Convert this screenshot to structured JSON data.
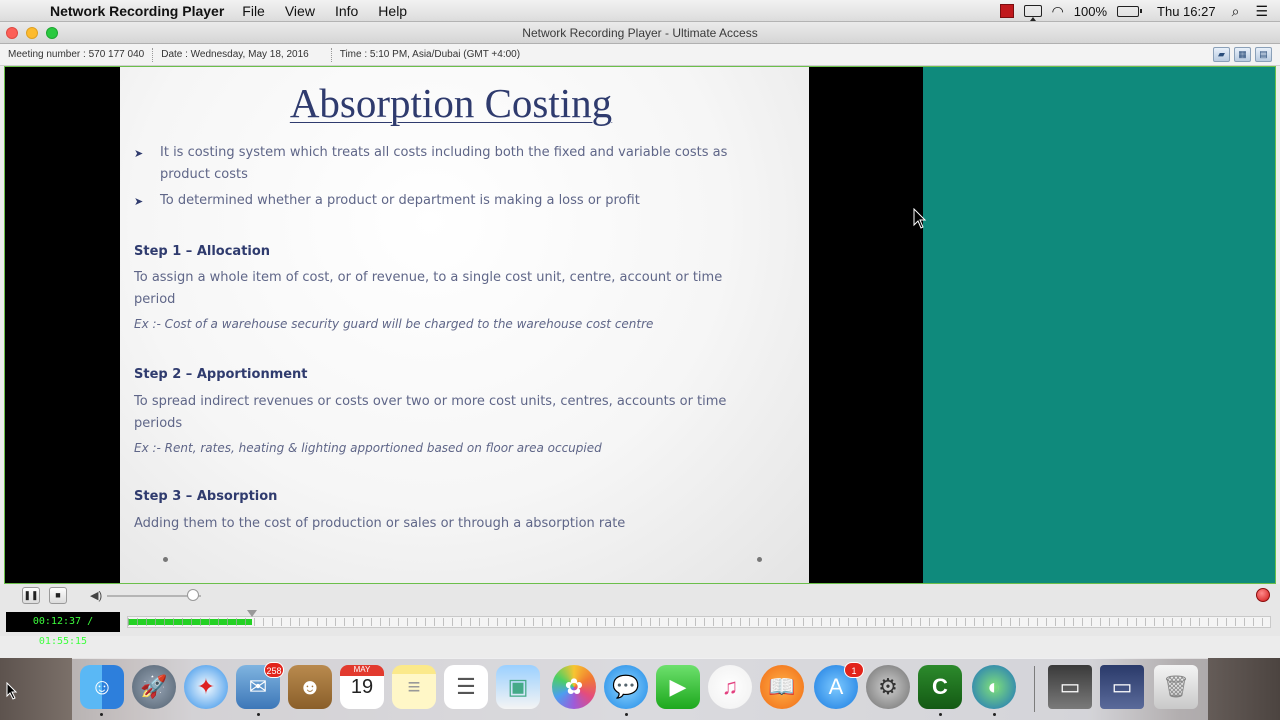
{
  "menubar": {
    "app_name": "Network Recording Player",
    "menus": [
      "File",
      "View",
      "Info",
      "Help"
    ],
    "battery": "100%",
    "clock": "Thu 16:27"
  },
  "window": {
    "title": "Network Recording Player - Ultimate Access",
    "meeting": "Meeting number : 570 177 040",
    "date": "Date : Wednesday, May 18, 2016",
    "time": "Time : 5:10 PM, Asia/Dubai (GMT +4:00)"
  },
  "slide": {
    "title": "Absorption Costing",
    "bullets": [
      "It is costing system which treats all costs including both the fixed and variable costs as",
      "product costs",
      "To determined whether a product or department is making a loss or profit"
    ],
    "steps": [
      {
        "heading": "Step 1 – Allocation",
        "lines": [
          "To assign a whole item of cost, or of revenue, to a single cost unit, centre, account or time",
          "period"
        ],
        "example": "Ex :- Cost of a warehouse security guard will be charged to the warehouse cost centre"
      },
      {
        "heading": "Step 2 – Apportionment",
        "lines": [
          "To spread indirect revenues or costs over two or more cost units, centres, accounts or time",
          "periods"
        ],
        "example": "Ex :- Rent, rates, heating & lighting  apportioned based on floor area occupied"
      },
      {
        "heading": "Step 3 – Absorption",
        "lines": [
          "Adding them to the cost of production or sales or through a absorption rate"
        ]
      }
    ]
  },
  "player": {
    "time_display": "00:12:37 / 01:55:15",
    "progress_fraction": 0.109,
    "volume_fraction": 0.92
  },
  "dock": {
    "mail_badge": "258",
    "appstore_badge": "1",
    "calendar_month": "MAY",
    "calendar_day": "19"
  },
  "colors": {
    "teal_panel": "#0f8a7c",
    "timeline_progress": "#23d123",
    "slide_title": "#2f3b6e"
  }
}
